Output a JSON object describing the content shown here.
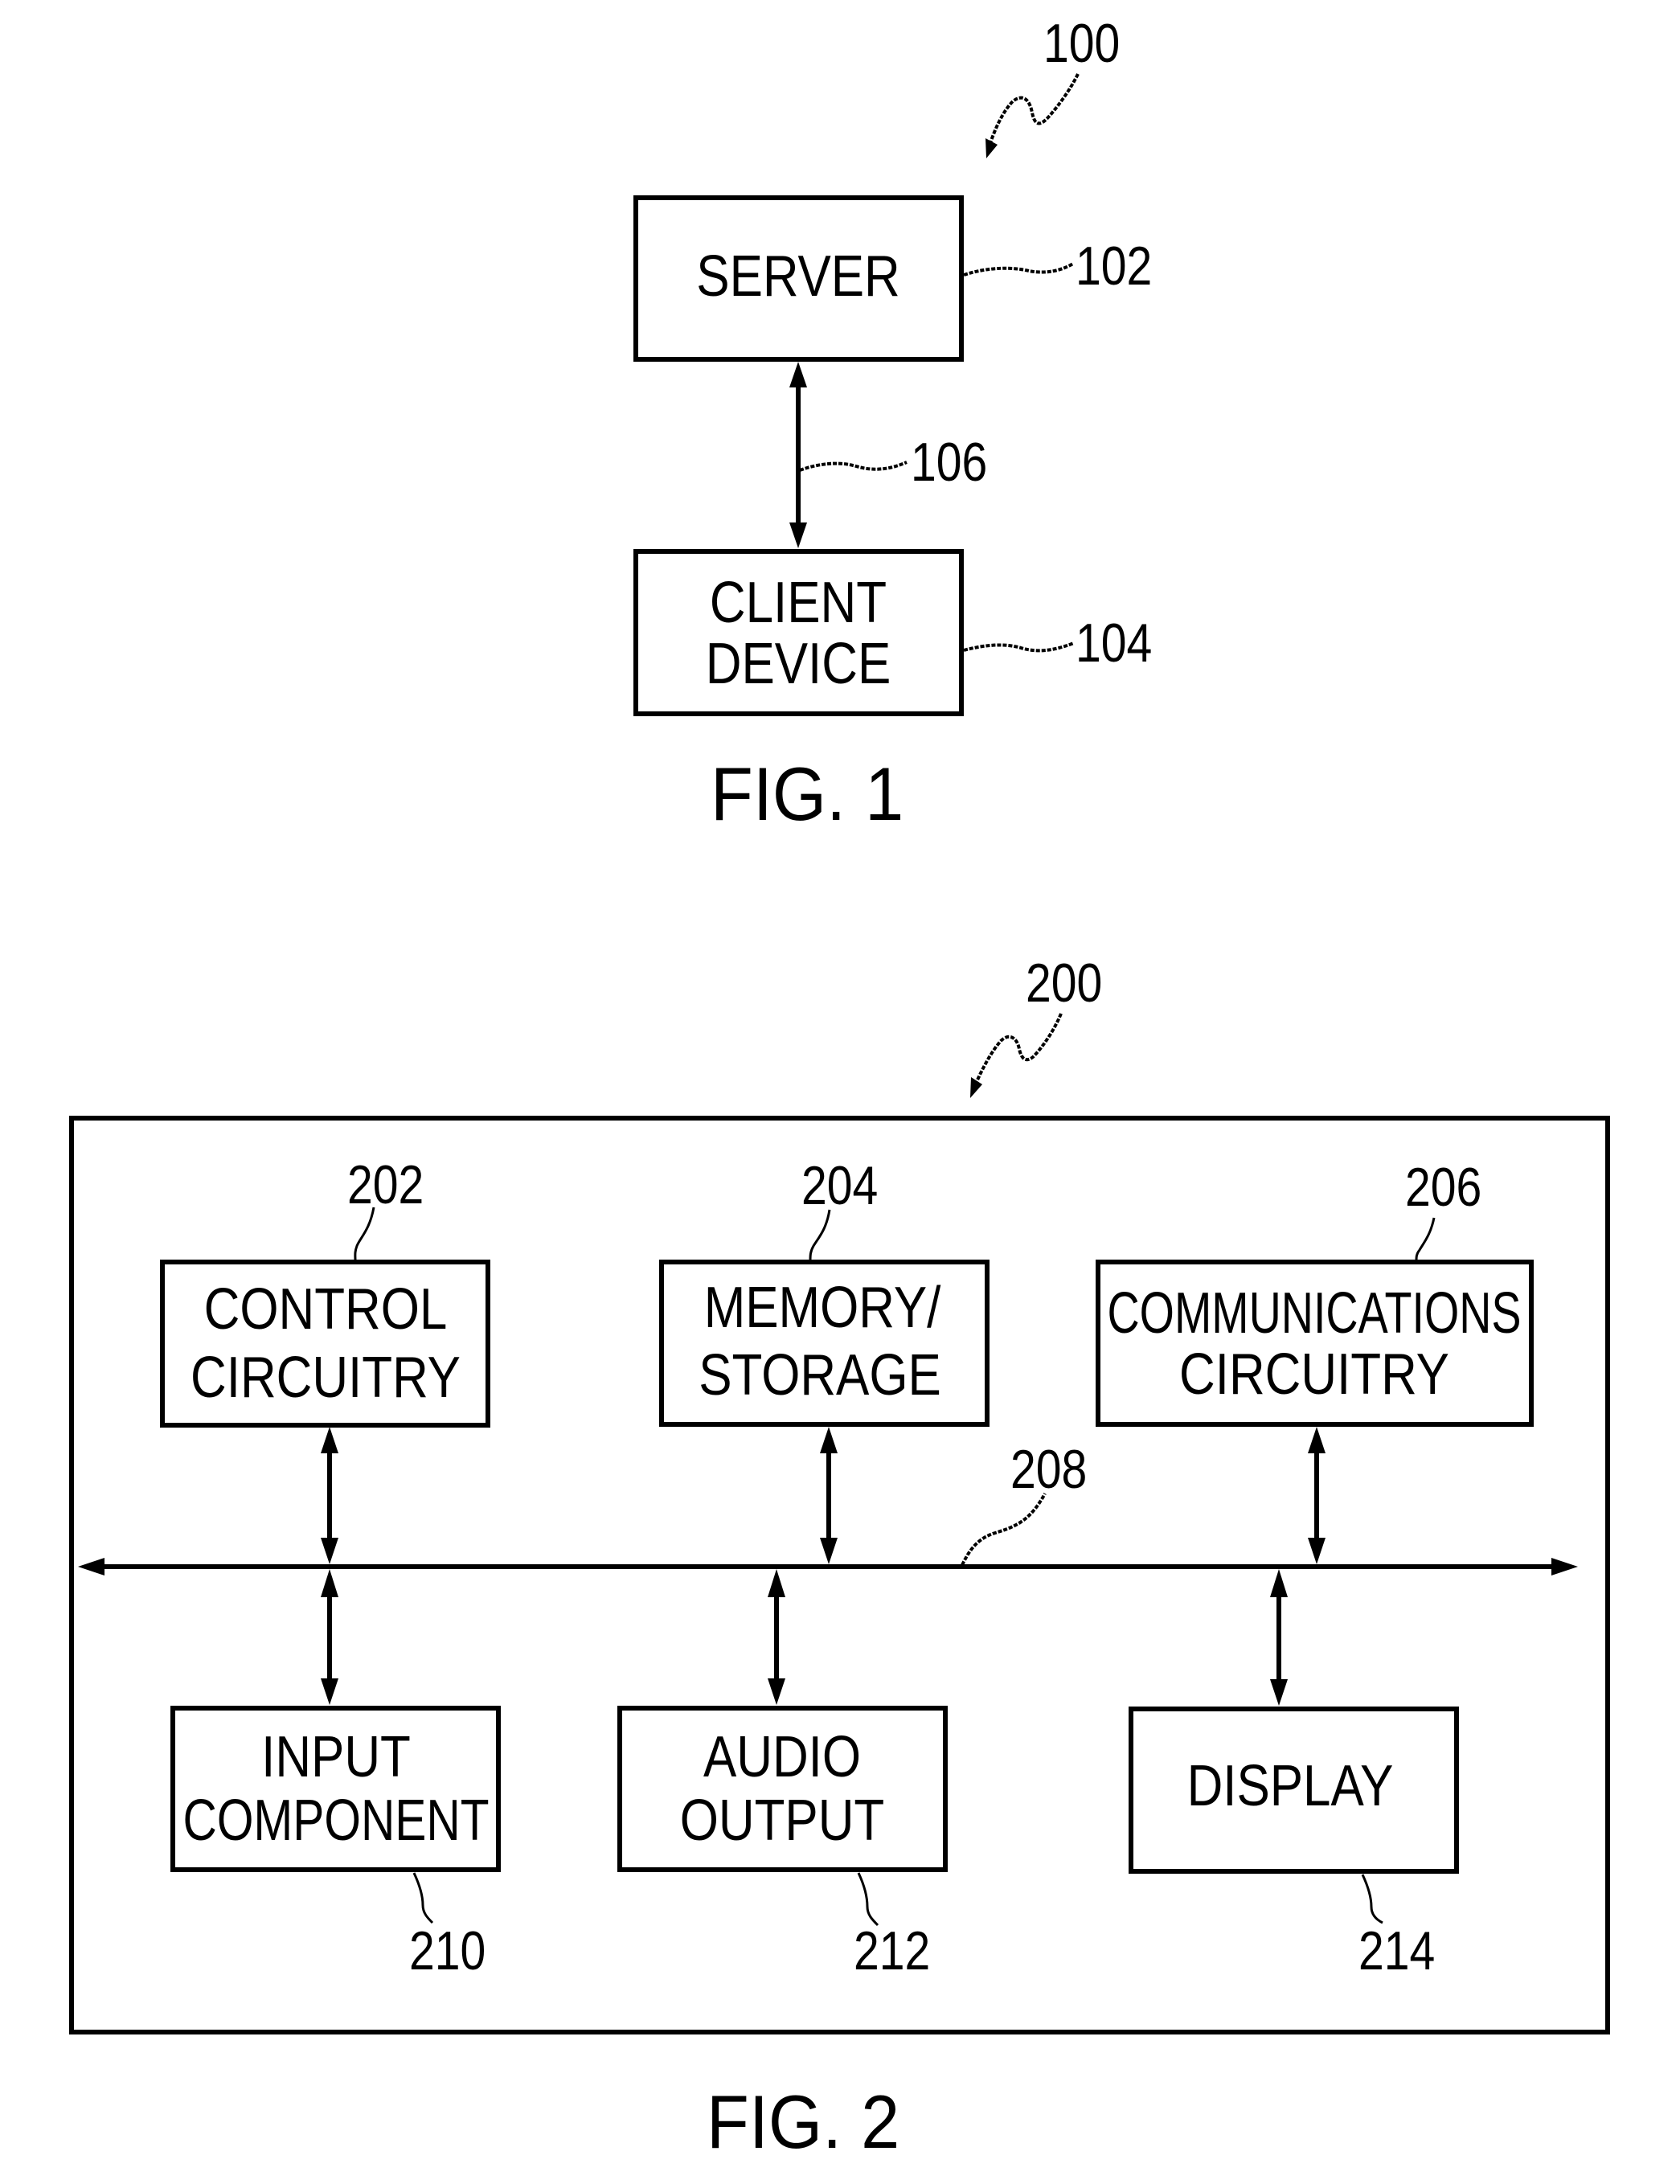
{
  "figures": [
    {
      "caption": "FIG. 1",
      "reference": "100",
      "blocks": {
        "server": {
          "lines": [
            "SERVER"
          ],
          "ref": "102"
        },
        "client_device": {
          "lines": [
            "CLIENT",
            "DEVICE"
          ],
          "ref": "104"
        }
      },
      "connection": {
        "ref": "106",
        "from": "server",
        "to": "client_device",
        "bidirectional": true
      }
    },
    {
      "caption": "FIG. 2",
      "reference": "200",
      "bus": {
        "ref": "208",
        "bidirectional": true
      },
      "blocks": {
        "control_circuitry": {
          "lines": [
            "CONTROL",
            "CIRCUITRY"
          ],
          "ref": "202"
        },
        "memory_storage": {
          "lines": [
            "MEMORY/",
            "STORAGE"
          ],
          "ref": "204"
        },
        "communications_circuitry": {
          "lines": [
            "COMMUNICATIONS",
            "CIRCUITRY"
          ],
          "ref": "206"
        },
        "input_component": {
          "lines": [
            "INPUT",
            "COMPONENT"
          ],
          "ref": "210"
        },
        "audio_output": {
          "lines": [
            "AUDIO",
            "OUTPUT"
          ],
          "ref": "212"
        },
        "display": {
          "lines": [
            "DISPLAY"
          ],
          "ref": "214"
        }
      }
    }
  ],
  "colors": {
    "ink": "#000000",
    "paper": "#ffffff"
  }
}
